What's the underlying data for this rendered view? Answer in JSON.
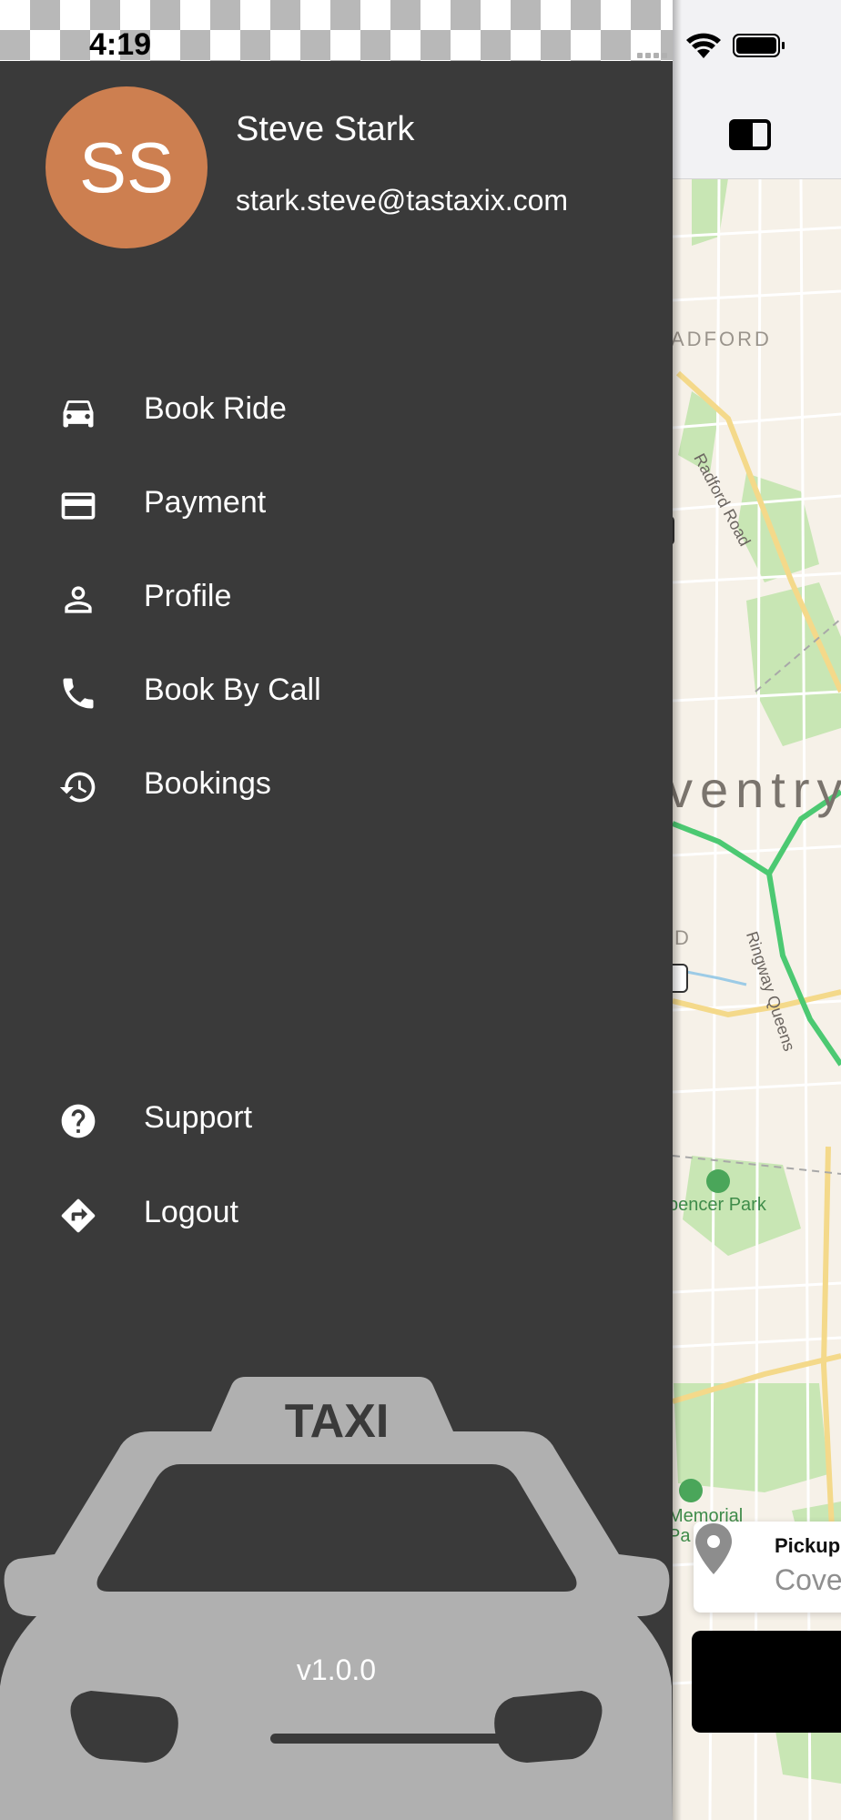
{
  "status_bar": {
    "time": "4:19"
  },
  "user": {
    "initials": "SS",
    "name": "Steve Stark",
    "email": "stark.steve@tastaxix.com",
    "avatar_color": "#cd7f50"
  },
  "menu": {
    "items": [
      {
        "label": "Book Ride",
        "icon": "car-icon"
      },
      {
        "label": "Payment",
        "icon": "credit-card-icon"
      },
      {
        "label": "Profile",
        "icon": "person-icon"
      },
      {
        "label": "Book By Call",
        "icon": "phone-icon"
      },
      {
        "label": "Bookings",
        "icon": "history-icon"
      }
    ],
    "footer_items": [
      {
        "label": "Support",
        "icon": "help-circle-icon"
      },
      {
        "label": "Logout",
        "icon": "directions-icon"
      }
    ]
  },
  "taxi_sign": "TAXI",
  "version": "v1.0.0",
  "map": {
    "labels": {
      "district_1": "ADFORD",
      "road_1": "Radford Road",
      "city": "ventry",
      "district_2": "D",
      "road_2": "Ringway Queens",
      "park_1": "pencer Park",
      "park_2_line1": "Memorial",
      "park_2_line2": "Pa"
    },
    "pickup": {
      "title": "Pickup",
      "value": "Cove"
    }
  },
  "colors": {
    "drawer_bg": "#3a3a3a",
    "map_bg": "#f6f1e8",
    "park_green": "#c8e6b4",
    "route_green": "#4cc972",
    "taxi_grey": "#b0b0b0"
  }
}
